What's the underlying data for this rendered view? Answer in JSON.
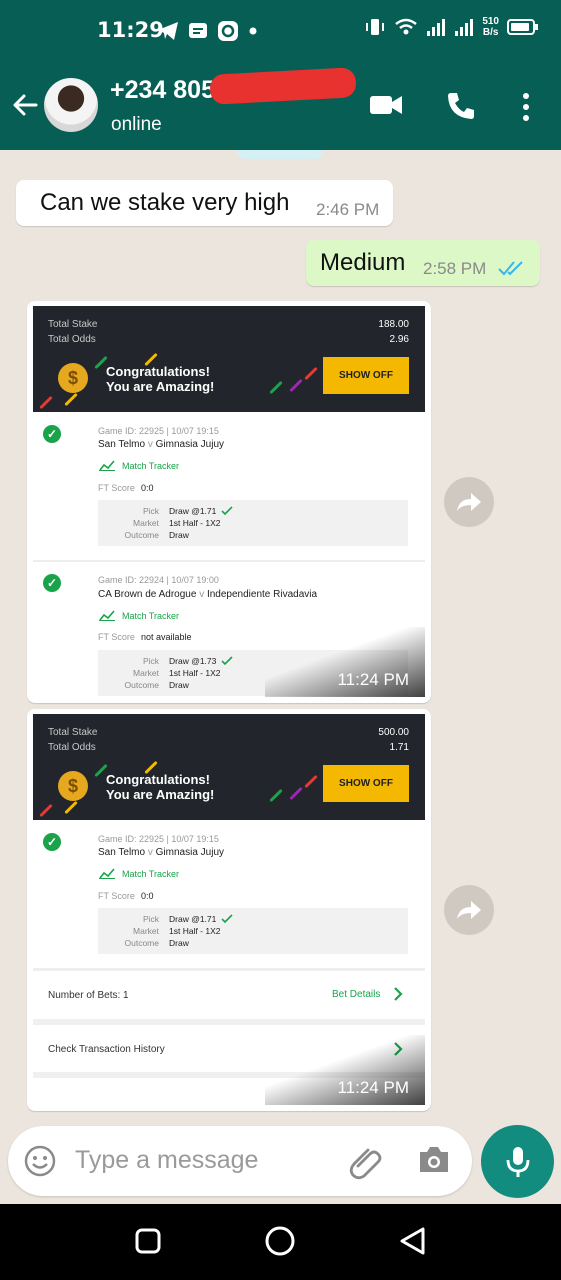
{
  "status_bar": {
    "time": "11:29",
    "net_speed_value": "510",
    "net_speed_unit": "B/s"
  },
  "header": {
    "contact_name": "+234 805",
    "contact_status": "online"
  },
  "messages": {
    "m1": {
      "text": "Can we stake very high",
      "time": "2:46 PM"
    },
    "m2": {
      "text": "Medium",
      "time": "2:58 PM",
      "read": true
    }
  },
  "slip1": {
    "total_stake_label": "Total Stake",
    "total_stake": "188.00",
    "total_odds_label": "Total Odds",
    "total_odds": "2.96",
    "congrats_line1": "Congratulations!",
    "congrats_line2": "You are Amazing!",
    "show_off": "SHOW OFF",
    "games": [
      {
        "game_id": "Game ID: 22925 | 10/07 19:15",
        "home": "San Telmo",
        "vs": "v",
        "away": "Gimnasia Jujuy",
        "tracker": "Match Tracker",
        "ft_label": "FT Score",
        "ft_value": "0:0",
        "pick_label": "Pick",
        "pick": "Draw @1.71",
        "market_label": "Market",
        "market": "1st Half - 1X2",
        "outcome_label": "Outcome",
        "outcome": "Draw"
      },
      {
        "game_id": "Game ID: 22924 | 10/07 19:00",
        "home": "CA Brown de Adrogue",
        "vs": "v",
        "away": "Independiente Rivadavia",
        "tracker": "Match Tracker",
        "ft_label": "FT Score",
        "ft_value": "not available",
        "pick_label": "Pick",
        "pick": "Draw @1.73",
        "market_label": "Market",
        "market": "1st Half - 1X2",
        "outcome_label": "Outcome",
        "outcome": "Draw"
      }
    ],
    "time": "11:24 PM"
  },
  "slip2": {
    "total_stake_label": "Total Stake",
    "total_stake": "500.00",
    "total_odds_label": "Total Odds",
    "total_odds": "1.71",
    "congrats_line1": "Congratulations!",
    "congrats_line2": "You are Amazing!",
    "show_off": "SHOW OFF",
    "game": {
      "game_id": "Game ID: 22925 | 10/07 19:15",
      "home": "San Telmo",
      "vs": "v",
      "away": "Gimnasia Jujuy",
      "tracker": "Match Tracker",
      "ft_label": "FT Score",
      "ft_value": "0:0",
      "pick_label": "Pick",
      "pick": "Draw @1.71",
      "market_label": "Market",
      "market": "1st Half - 1X2",
      "outcome_label": "Outcome",
      "outcome": "Draw"
    },
    "number_of_bets": "Number of Bets: 1",
    "bet_details": "Bet Details",
    "check_history": "Check Transaction History",
    "time": "11:24 PM"
  },
  "input": {
    "placeholder": "Type a message"
  },
  "colors": {
    "header": "#075e54",
    "accent": "#128c7e",
    "outgoing": "#dcf8c6",
    "read_tick": "#34b7f1",
    "win_green": "#1aa34a",
    "show_off": "#f5b800"
  },
  "icons": [
    "back-arrow-icon",
    "video-call-icon",
    "voice-call-icon",
    "more-options-icon",
    "forward-icon",
    "emoji-icon",
    "attach-icon",
    "camera-icon",
    "mic-icon",
    "read-ticks-icon",
    "check-circle-icon",
    "match-tracker-icon",
    "chevron-right-icon",
    "nav-recent-icon",
    "nav-home-icon",
    "nav-back-icon"
  ]
}
